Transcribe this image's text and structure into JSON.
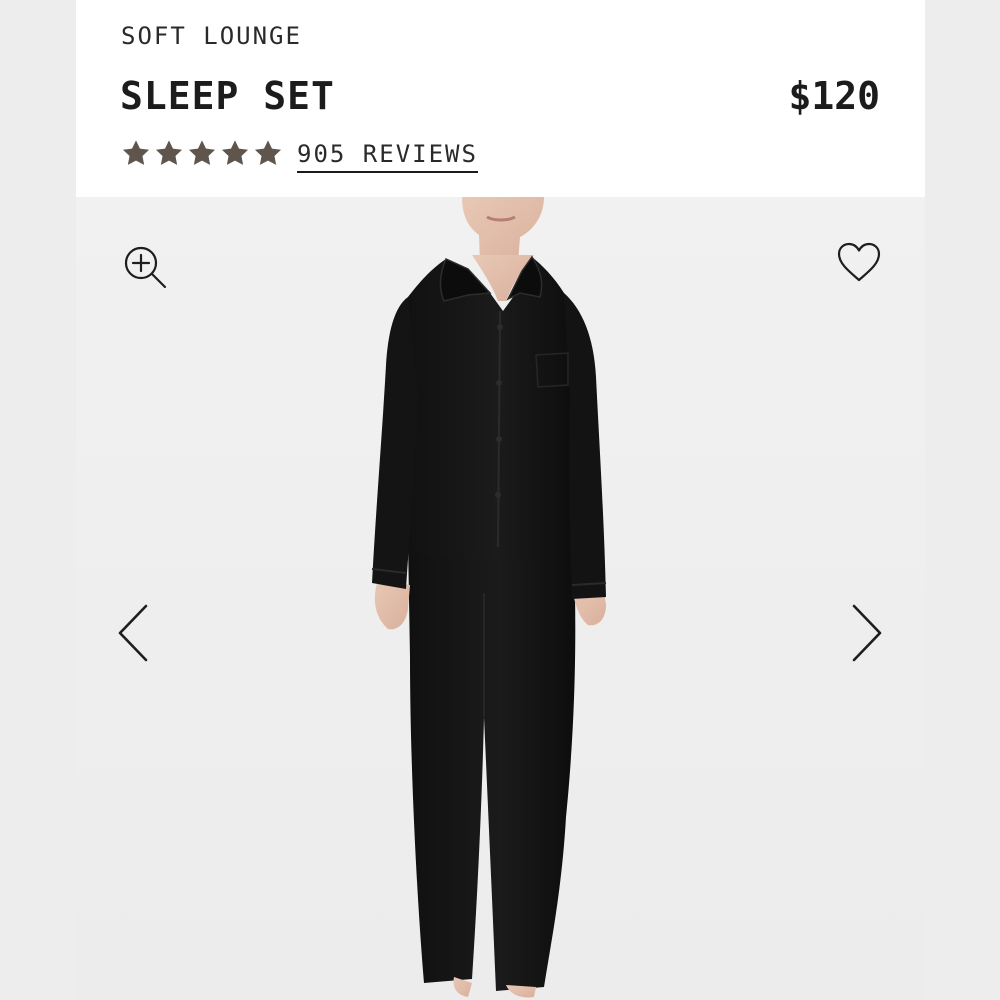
{
  "product": {
    "collection": "SOFT LOUNGE",
    "name": "SLEEP SET",
    "price": "$120",
    "rating": 5,
    "rating_max": 5,
    "reviews_label": "905 REVIEWS"
  },
  "icons": {
    "zoom": "zoom-in-icon",
    "favorite": "heart-icon",
    "previous": "chevron-left-icon",
    "next": "chevron-right-icon",
    "rating": "star-icon"
  },
  "colors": {
    "star": "#5f554c",
    "text": "#1c1c1c",
    "garment": "#141414",
    "background": "#f0f0f0"
  }
}
